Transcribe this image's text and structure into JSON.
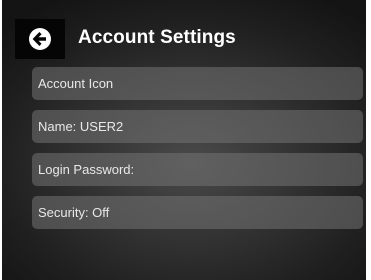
{
  "header": {
    "title": "Account Settings",
    "back_icon": "back-arrow-icon"
  },
  "settings": {
    "items": [
      {
        "label": "Account Icon"
      },
      {
        "label": "Name: USER2"
      },
      {
        "label": "Login Password:"
      },
      {
        "label": "Security: Off"
      }
    ]
  }
}
